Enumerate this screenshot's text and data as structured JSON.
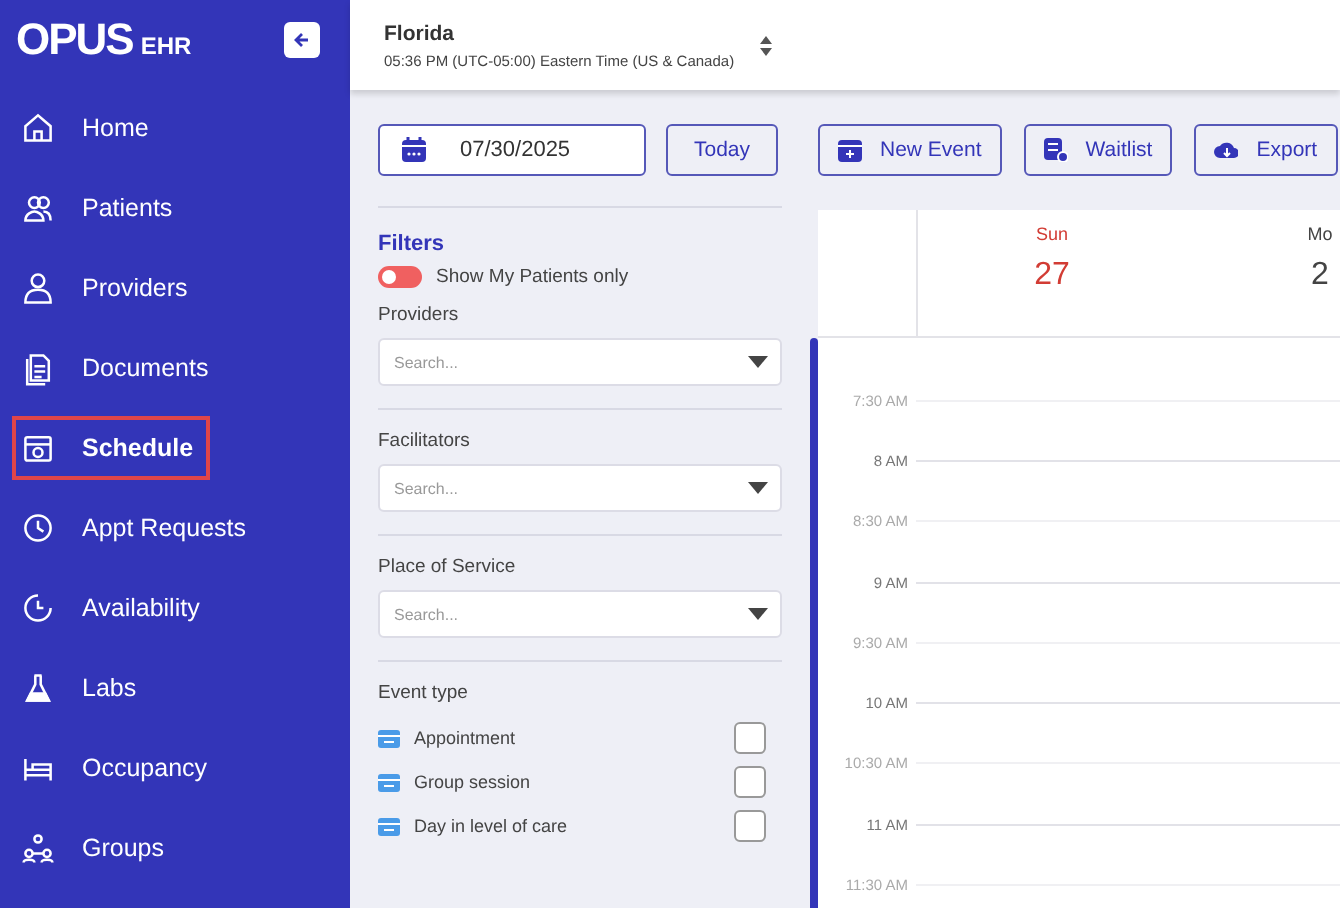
{
  "logo": {
    "brand": "OPUS",
    "suffix": "EHR"
  },
  "header": {
    "location": "Florida",
    "timezone": "05:36 PM (UTC-05:00) Eastern Time (US & Canada)"
  },
  "sidebar": {
    "items": [
      {
        "label": "Home",
        "selected": false
      },
      {
        "label": "Patients",
        "selected": false
      },
      {
        "label": "Providers",
        "selected": false
      },
      {
        "label": "Documents",
        "selected": false
      },
      {
        "label": "Schedule",
        "selected": true
      },
      {
        "label": "Appt Requests",
        "selected": false
      },
      {
        "label": "Availability",
        "selected": false
      },
      {
        "label": "Labs",
        "selected": false
      },
      {
        "label": "Occupancy",
        "selected": false
      },
      {
        "label": "Groups",
        "selected": false
      }
    ]
  },
  "toolbar": {
    "date": "07/30/2025",
    "today": "Today",
    "buttons": [
      {
        "label": "New Event"
      },
      {
        "label": "Waitlist"
      },
      {
        "label": "Export"
      }
    ]
  },
  "filters": {
    "title": "Filters",
    "toggle": {
      "label": "Show My Patients only",
      "on": false
    },
    "selects": [
      {
        "label": "Providers",
        "placeholder": "Search..."
      },
      {
        "label": "Facilitators",
        "placeholder": "Search..."
      },
      {
        "label": "Place of Service",
        "placeholder": "Search..."
      }
    ],
    "event_type": {
      "label": "Event type",
      "items": [
        {
          "label": "Appointment",
          "checked": false
        },
        {
          "label": "Group session",
          "checked": false
        },
        {
          "label": "Day in level of care",
          "checked": false
        }
      ]
    }
  },
  "calendar": {
    "days": [
      {
        "name": "Sun",
        "date": "27",
        "weekend": true
      },
      {
        "name": "Mo",
        "date": "2",
        "weekend": false
      }
    ],
    "times": [
      {
        "label": "7:30 AM",
        "major": false
      },
      {
        "label": "8 AM",
        "major": true
      },
      {
        "label": "8:30 AM",
        "major": false
      },
      {
        "label": "9 AM",
        "major": true
      },
      {
        "label": "9:30 AM",
        "major": false
      },
      {
        "label": "10 AM",
        "major": true
      },
      {
        "label": "10:30 AM",
        "major": false
      },
      {
        "label": "11 AM",
        "major": true
      },
      {
        "label": "11:30 AM",
        "major": false
      }
    ]
  }
}
